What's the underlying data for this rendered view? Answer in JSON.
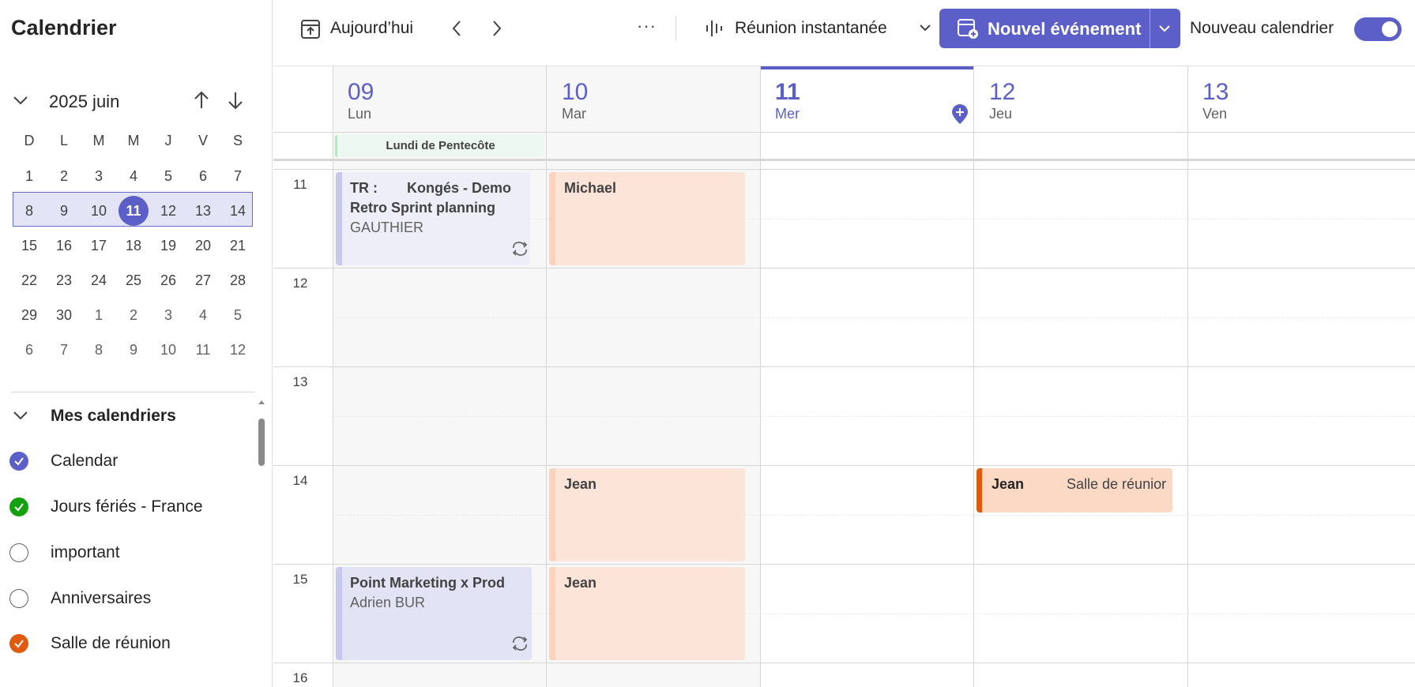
{
  "sidebar": {
    "title": "Calendrier",
    "month_label": "2025 juin",
    "weekdays": [
      "D",
      "L",
      "M",
      "M",
      "J",
      "V",
      "S"
    ],
    "weeks": [
      [
        "1",
        "2",
        "3",
        "4",
        "5",
        "6",
        "7"
      ],
      [
        "8",
        "9",
        "10",
        "11",
        "12",
        "13",
        "14"
      ],
      [
        "15",
        "16",
        "17",
        "18",
        "19",
        "20",
        "21"
      ],
      [
        "22",
        "23",
        "24",
        "25",
        "26",
        "27",
        "28"
      ],
      [
        "29",
        "30",
        "1",
        "2",
        "3",
        "4",
        "5"
      ],
      [
        "6",
        "7",
        "8",
        "9",
        "10",
        "11",
        "12"
      ]
    ],
    "selected_day": "11",
    "calendars_header": "Mes calendriers",
    "calendars": [
      {
        "label": "Calendar",
        "checked": true,
        "color": "#5b5fc7"
      },
      {
        "label": "Jours fériés - France",
        "checked": true,
        "color": "#13a10e"
      },
      {
        "label": "important",
        "checked": false,
        "color": "#616161"
      },
      {
        "label": "Anniversaires",
        "checked": false,
        "color": "#616161"
      },
      {
        "label": "Salle de réunion",
        "checked": true,
        "color": "#e05a10"
      }
    ]
  },
  "toolbar": {
    "today_label": "Aujourd’hui",
    "more_label": "···",
    "meet_now_label": "Réunion instantanée",
    "new_event_label": "Nouvel événement",
    "new_calendar_label": "Nouveau calendrier",
    "new_calendar_on": true
  },
  "days": [
    {
      "num": "09",
      "name": "Lun"
    },
    {
      "num": "10",
      "name": "Mar"
    },
    {
      "num": "11",
      "name": "Mer"
    },
    {
      "num": "12",
      "name": "Jeu"
    },
    {
      "num": "13",
      "name": "Ven"
    }
  ],
  "all_day": {
    "label": "Lundi de Pentecôte"
  },
  "hours": [
    "11",
    "12",
    "13",
    "14",
    "15",
    "16"
  ],
  "events": {
    "retro": {
      "prefix": "TR :",
      "title_rest": "Kongés - Demo",
      "title_line2": "Retro Sprint planning",
      "organizer": "GAUTHIER"
    },
    "michael": {
      "title": "Michael"
    },
    "jean_tue_14": {
      "title": "Jean"
    },
    "jean_thu_14": {
      "title": "Jean",
      "location": "Salle de réunior"
    },
    "marketing": {
      "title": "Point Marketing x Prod",
      "organizer": "Adrien BUR"
    },
    "jean_tue_15": {
      "title": "Jean"
    }
  },
  "colors": {
    "accent": "#5b5fc7",
    "event_purple": "#e3e3f6",
    "event_peach": "#fde4d8",
    "room_orange": "#e05a10"
  }
}
